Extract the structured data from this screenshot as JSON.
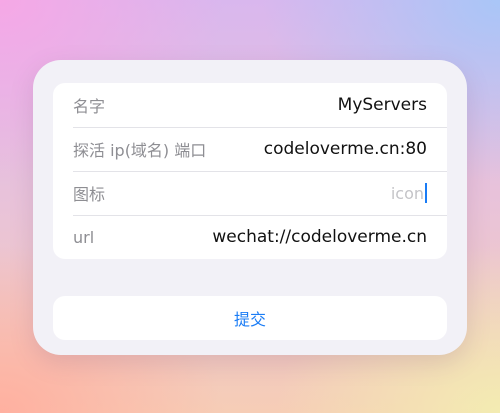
{
  "form": {
    "fields": [
      {
        "label": "名字",
        "value": "MyServers"
      },
      {
        "label": "探活 ip(域名) 端口",
        "value": "codeloverme.cn:80"
      },
      {
        "label": "图标",
        "value": "",
        "placeholder": "icon"
      },
      {
        "label": "url",
        "value": "wechat://codeloverme.cn"
      }
    ],
    "submit_label": "提交"
  },
  "colors": {
    "accent": "#1a7cf5",
    "card_background": "#f2f1f7",
    "label": "#8e8e93"
  }
}
